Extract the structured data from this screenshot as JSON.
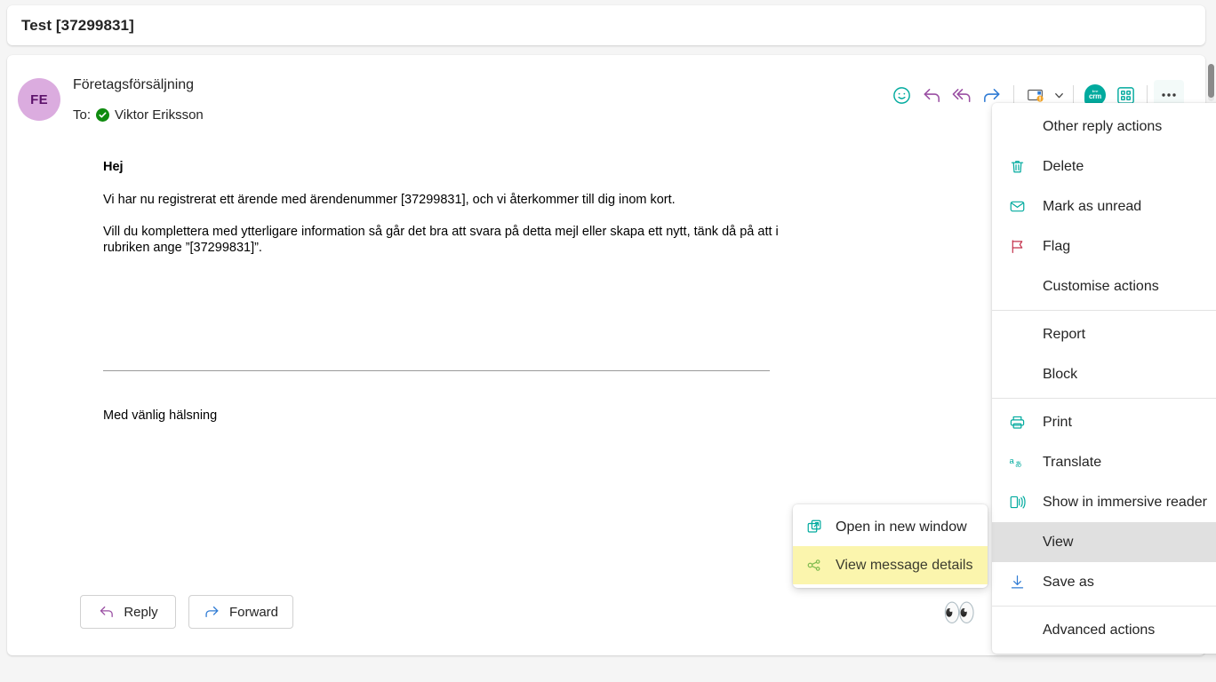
{
  "subject": {
    "text": "Test [37299831]"
  },
  "message": {
    "avatar_initials": "FE",
    "sender": "Företagsförsäljning",
    "to_label": "To:",
    "recipient": "Viktor Eriksson",
    "body": {
      "greeting": "Hej",
      "paragraph1": "Vi har nu registrerat ett ärende med ärendenummer [37299831], och vi återkommer till dig inom kort.",
      "paragraph2": "Vill du komplettera med ytterligare information så går det bra att svara på detta mejl eller skapa ett nytt, tänk då på att i rubriken ange ”[37299831]”.",
      "signature": "Med vänlig hälsning"
    },
    "reactions": {
      "eyes": "👀"
    }
  },
  "toolbar": {
    "items": [
      {
        "icon": "emoji-react-icon",
        "label": "React"
      },
      {
        "icon": "reply-icon",
        "label": "Reply"
      },
      {
        "icon": "reply-all-icon",
        "label": "Reply all"
      },
      {
        "icon": "forward-icon",
        "label": "Forward"
      },
      {
        "icon": "quick-steps-icon",
        "label": "Quick steps"
      },
      {
        "icon": "crm-icon",
        "label": "CRM"
      },
      {
        "icon": "apps-icon",
        "label": "Apps"
      },
      {
        "icon": "more-options-icon",
        "label": "More actions"
      }
    ]
  },
  "footer": {
    "reply_label": "Reply",
    "forward_label": "Forward"
  },
  "context_menu": {
    "items": [
      {
        "label": "Other reply actions",
        "icon": "none",
        "submenu": true,
        "selected": false,
        "divider_after": false
      },
      {
        "label": "Delete",
        "icon": "trash-icon",
        "submenu": false,
        "selected": false,
        "divider_after": false
      },
      {
        "label": "Mark as unread",
        "icon": "envelope-icon",
        "submenu": false,
        "selected": false,
        "divider_after": false
      },
      {
        "label": "Flag",
        "icon": "flag-icon",
        "submenu": false,
        "selected": false,
        "divider_after": false
      },
      {
        "label": "Customise actions",
        "icon": "none",
        "submenu": false,
        "selected": false,
        "divider_after": true
      },
      {
        "label": "Report",
        "icon": "none",
        "submenu": true,
        "selected": false,
        "divider_after": false
      },
      {
        "label": "Block",
        "icon": "none",
        "submenu": true,
        "selected": false,
        "divider_after": true
      },
      {
        "label": "Print",
        "icon": "printer-icon",
        "submenu": false,
        "selected": false,
        "divider_after": false
      },
      {
        "label": "Translate",
        "icon": "translate-icon",
        "submenu": false,
        "selected": false,
        "divider_after": false
      },
      {
        "label": "Show in immersive reader",
        "icon": "immersive-reader-icon",
        "submenu": false,
        "selected": false,
        "divider_after": false
      },
      {
        "label": "View",
        "icon": "none",
        "submenu": true,
        "selected": true,
        "divider_after": false
      },
      {
        "label": "Save as",
        "icon": "download-icon",
        "submenu": false,
        "selected": false,
        "divider_after": true
      },
      {
        "label": "Advanced actions",
        "icon": "none",
        "submenu": true,
        "selected": false,
        "divider_after": false
      }
    ]
  },
  "view_submenu": {
    "items": [
      {
        "label": "Open in new window",
        "icon": "open-external-icon",
        "highlighted": false
      },
      {
        "label": "View message details",
        "icon": "message-details-icon",
        "highlighted": true
      }
    ]
  },
  "colors": {
    "accent_teal": "#00aa9e",
    "reply_purple": "#9a4fa3",
    "forward_blue": "#2f7bd4",
    "flag_red": "#c4314b",
    "avatar_bg": "#dbacdf",
    "highlight_yellow": "#fbf5ad",
    "selected_grey": "#e0e0e0",
    "verified_green": "#0f8b0f"
  }
}
